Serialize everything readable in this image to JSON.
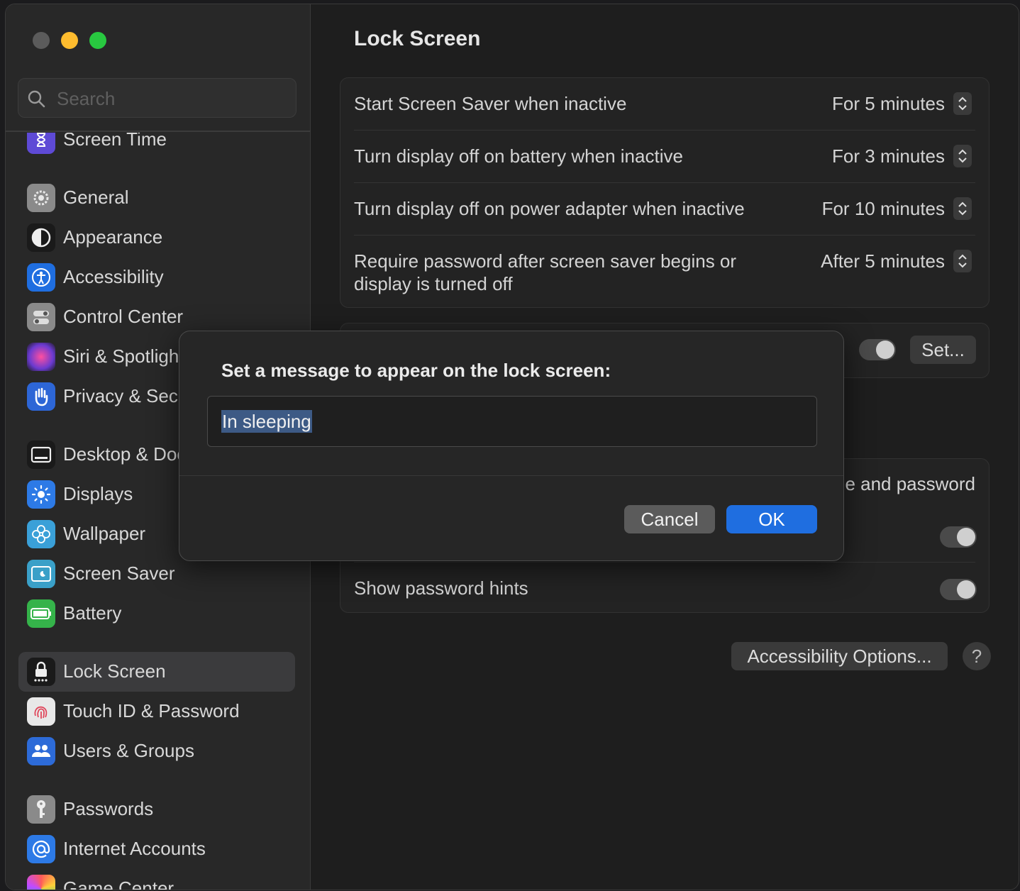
{
  "window": {
    "controls": [
      "close",
      "minimize",
      "zoom"
    ]
  },
  "sidebar": {
    "search": {
      "placeholder": "Search"
    },
    "items": [
      {
        "label": "Screen Time",
        "icon": "hourglass-icon",
        "color": "#5e4ad6",
        "active": false
      },
      {
        "label": "General",
        "icon": "gear-icon",
        "color": "#8a8a8a",
        "active": false
      },
      {
        "label": "Appearance",
        "icon": "appearance-icon",
        "color": "#1a1a1a",
        "active": false
      },
      {
        "label": "Accessibility",
        "icon": "accessibility-icon",
        "color": "#1f6ee0",
        "active": false
      },
      {
        "label": "Control Center",
        "icon": "control-center-icon",
        "color": "#8a8a8a",
        "active": false
      },
      {
        "label": "Siri & Spotlight",
        "icon": "siri-icon",
        "color": "#b03ad0",
        "active": false
      },
      {
        "label": "Privacy & Security",
        "icon": "hand-icon",
        "color": "#2d66d6",
        "active": false
      },
      {
        "label": "Desktop & Dock",
        "icon": "dock-icon",
        "color": "#1a1a1a",
        "active": false
      },
      {
        "label": "Displays",
        "icon": "sun-icon",
        "color": "#2d7ae6",
        "active": false
      },
      {
        "label": "Wallpaper",
        "icon": "flower-icon",
        "color": "#3aa0d8",
        "active": false
      },
      {
        "label": "Screen Saver",
        "icon": "screen-saver-icon",
        "color": "#3aa0c8",
        "active": false
      },
      {
        "label": "Battery",
        "icon": "battery-icon",
        "color": "#35b34a",
        "active": false
      },
      {
        "label": "Lock Screen",
        "icon": "lock-icon",
        "color": "#1a1a1a",
        "active": true
      },
      {
        "label": "Touch ID & Password",
        "icon": "fingerprint-icon",
        "color": "#e0e0e0",
        "active": false
      },
      {
        "label": "Users & Groups",
        "icon": "users-icon",
        "color": "#2d6bd8",
        "active": false
      },
      {
        "label": "Passwords",
        "icon": "key-icon",
        "color": "#8a8a8a",
        "active": false
      },
      {
        "label": "Internet Accounts",
        "icon": "at-icon",
        "color": "#2d7ae6",
        "active": false
      },
      {
        "label": "Game Center",
        "icon": "game-center-icon",
        "color": "#e0e0e0",
        "active": false
      }
    ]
  },
  "main": {
    "title": "Lock Screen",
    "settings": [
      {
        "label": "Start Screen Saver when inactive",
        "value": "For 5 minutes"
      },
      {
        "label": "Turn display off on battery when inactive",
        "value": "For 3 minutes"
      },
      {
        "label": "Turn display off on power adapter when inactive",
        "value": "For 10 minutes"
      },
      {
        "label": "Require password after screen saver begins or display is turned off",
        "value": "After 5 minutes"
      }
    ],
    "message_row": {
      "set_button": "Set..."
    },
    "login_group": {
      "partial_label": "e and password",
      "show_hints_label": "Show password hints"
    },
    "accessibility_button": "Accessibility Options...",
    "help_button": "?"
  },
  "dialog": {
    "title": "Set a message to appear on the lock screen:",
    "field_value": "In sleeping",
    "cancel": "Cancel",
    "ok": "OK"
  },
  "colors": {
    "accent": "#1f6ee0",
    "selection": "#3d5a85"
  }
}
